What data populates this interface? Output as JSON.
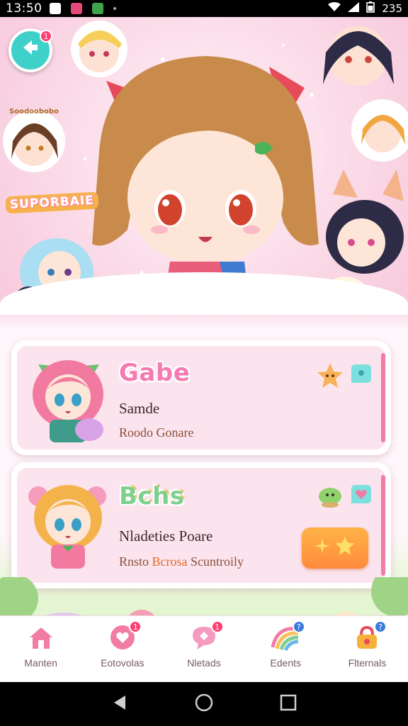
{
  "status_bar": {
    "time": "13:50",
    "right_text": "235",
    "icons": [
      "photo-icon",
      "notification-icon",
      "app-icon",
      "wifi-icon",
      "signal-icon",
      "battery-icon"
    ]
  },
  "header": {
    "back_badge": "1",
    "banner_text": "SUPORBAIE",
    "sticker_text": "Soodoobobo"
  },
  "cards": [
    {
      "title": "Gabe",
      "title_color": "#f47ab1",
      "subtitle": "Samde",
      "meta": "Roodo Gonare"
    },
    {
      "title": "Bchs",
      "title_color": "#7fcf8f",
      "subtitle": "Nladeties Poare",
      "meta_prefix": "Rnsto",
      "meta_highlight": "Bcrosa",
      "meta_suffix": "Scuntroily"
    }
  ],
  "bottom_nav": [
    {
      "label": "Manten",
      "icon": "home-icon",
      "badge": ""
    },
    {
      "label": "Eotovolas",
      "icon": "chat-heart-icon",
      "badge": "1"
    },
    {
      "label": "Nletads",
      "icon": "message-icon",
      "badge": "1"
    },
    {
      "label": "Edents",
      "icon": "rainbow-icon",
      "badge": "?"
    },
    {
      "label": "Flternals",
      "icon": "lock-bag-icon",
      "badge": "?"
    }
  ],
  "colors": {
    "accent_pink": "#f27ca4",
    "accent_teal": "#3fd0c9",
    "star_orange": "#ff8a3d",
    "badge_red": "#ff3d6e",
    "badge_blue": "#3b7bdc"
  }
}
